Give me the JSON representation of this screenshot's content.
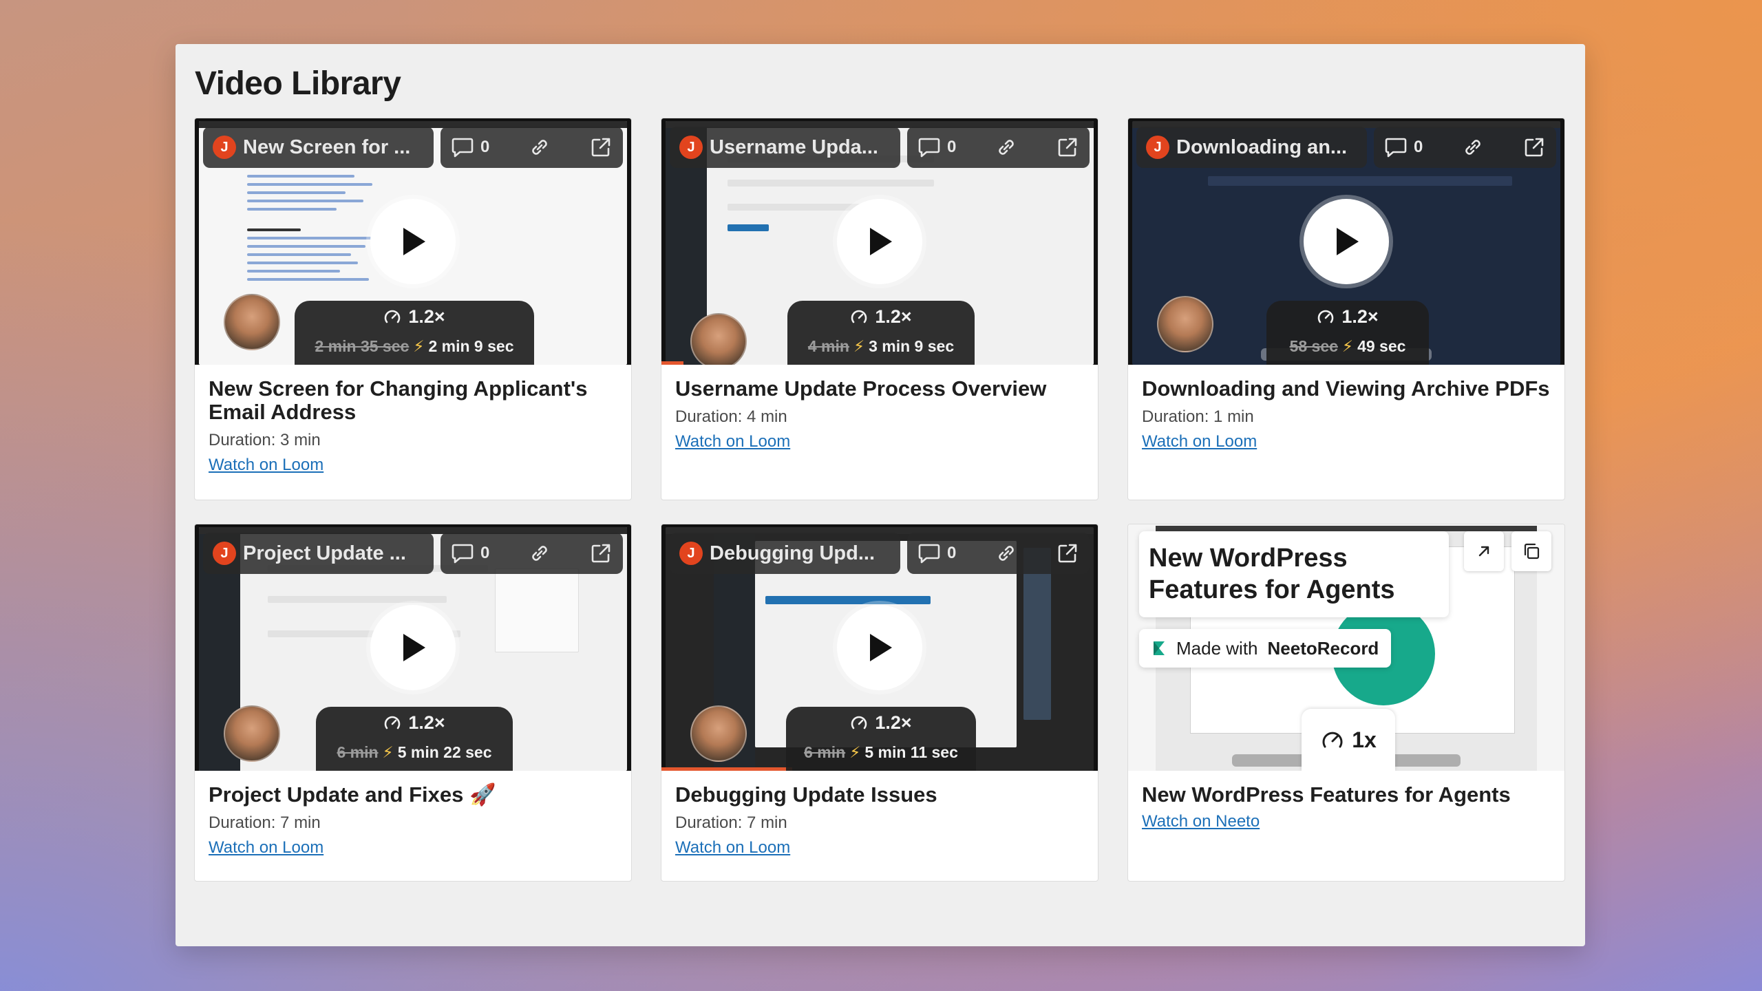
{
  "page": {
    "title": "Video Library"
  },
  "videos": [
    {
      "pill_title": "New Screen for ...",
      "avatar_initial": "J",
      "comment_count": "0",
      "speed_label": "1.2×",
      "old_duration": "2 min 35 sec",
      "new_duration": "2 min 9 sec",
      "title": "New Screen for Changing Applicant's Email Address",
      "duration": "Duration: 3 min",
      "link_label": "Watch on Loom",
      "progress": 0
    },
    {
      "pill_title": "Username Upda...",
      "avatar_initial": "J",
      "comment_count": "0",
      "speed_label": "1.2×",
      "old_duration": "4 min",
      "new_duration": "3 min 9 sec",
      "title": "Username Update Process Overview",
      "duration": "Duration: 4 min",
      "link_label": "Watch on Loom",
      "progress": 0.05
    },
    {
      "pill_title": "Downloading an...",
      "avatar_initial": "J",
      "comment_count": "0",
      "speed_label": "1.2×",
      "old_duration": "58 sec",
      "new_duration": "49 sec",
      "title": "Downloading and Viewing Archive PDFs",
      "duration": "Duration: 1 min",
      "link_label": "Watch on Loom",
      "progress": 0
    },
    {
      "pill_title": "Project Update ...",
      "avatar_initial": "J",
      "comment_count": "0",
      "speed_label": "1.2×",
      "old_duration": "6 min",
      "new_duration": "5 min 22 sec",
      "title": "Project Update and Fixes 🚀",
      "duration": "Duration: 7 min",
      "link_label": "Watch on Loom",
      "progress": 0
    },
    {
      "pill_title": "Debugging Upd...",
      "avatar_initial": "J",
      "comment_count": "0",
      "speed_label": "1.2×",
      "old_duration": "6 min",
      "new_duration": "5 min 11 sec",
      "title": "Debugging Update Issues",
      "duration": "Duration: 7 min",
      "link_label": "Watch on Loom",
      "progress": 0.3
    }
  ],
  "neeto": {
    "overlay_title": "New WordPress Features for Agents",
    "made_with_prefix": "Made with",
    "made_with_brand": "NeetoRecord",
    "speed_label": "1x",
    "title": "New WordPress Features for Agents",
    "link_label": "Watch on Neeto"
  },
  "colors": {
    "loom_avatar": "#e2441e",
    "link": "#1b6fb8",
    "neeto_green": "#17a98b",
    "progress": "#e4572e"
  },
  "icons": [
    "comment-icon",
    "link-icon",
    "external-link-icon",
    "play-icon",
    "speed-gauge-icon",
    "bolt-icon",
    "expand-icon",
    "copy-icon",
    "neeto-leaf-icon"
  ]
}
